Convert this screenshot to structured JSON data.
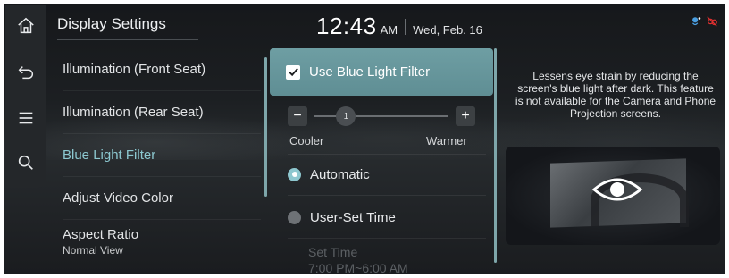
{
  "header": {
    "title": "Display Settings",
    "time": "12:43",
    "ampm": "AM",
    "date": "Wed, Feb. 16"
  },
  "rail": {
    "items": [
      "home-icon",
      "back-icon",
      "menu-icon",
      "search-icon"
    ]
  },
  "menu": {
    "items": [
      {
        "label": "Illumination (Front Seat)",
        "sub": ""
      },
      {
        "label": "Illumination (Rear Seat)",
        "sub": ""
      },
      {
        "label": "Blue Light Filter",
        "sub": "",
        "active": true
      },
      {
        "label": "Adjust Video Color",
        "sub": ""
      },
      {
        "label": "Aspect Ratio",
        "sub": "Normal View"
      }
    ]
  },
  "filter": {
    "label": "Use Blue Light Filter",
    "checked": true,
    "level": 1,
    "cooler_label": "Cooler",
    "warmer_label": "Warmer",
    "minus": "−",
    "plus": "+",
    "options": [
      {
        "label": "Automatic",
        "selected": true
      },
      {
        "label": "User-Set Time",
        "selected": false
      }
    ],
    "set_time_label": "Set Time",
    "set_time_value": "7:00 PM~6:00 AM"
  },
  "description": "Lessens eye strain by reducing the screen's blue light after dark. This feature is not available for the Camera and Phone Projection screens.",
  "colors": {
    "accent": "#8cc8d0",
    "selected_row": "#6e9ea3"
  }
}
